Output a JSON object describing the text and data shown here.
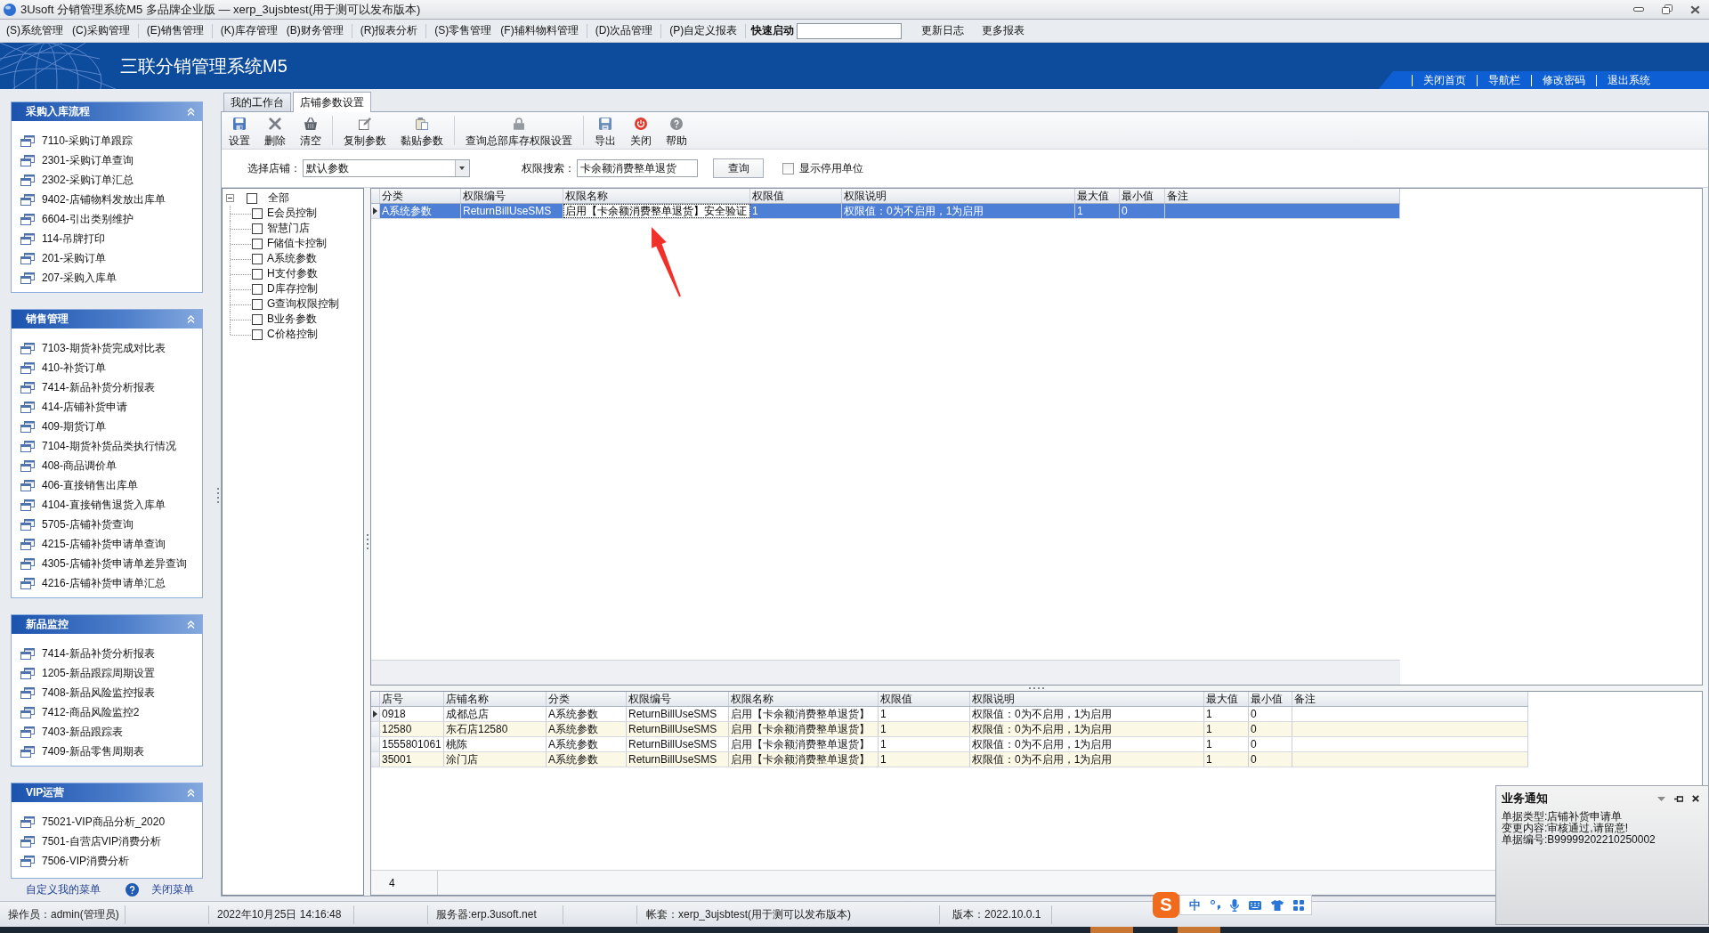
{
  "window": {
    "title": "3Usoft 分销管理系统M5 多品牌企业版 — xerp_3ujsbtest(用于测可以发布版本)"
  },
  "menu_bar": {
    "groups": [
      [
        "(S)系统管理",
        "(C)采购管理"
      ],
      [
        "(E)销售管理"
      ],
      [
        "(K)库存管理",
        "(B)财务管理"
      ],
      [
        "(R)报表分析"
      ],
      [
        "(S)零售管理",
        "(F)辅料物料管理"
      ],
      [
        "(D)次品管理"
      ],
      [
        "(P)自定义报表"
      ]
    ],
    "quick_launch": {
      "label": "快速启动"
    },
    "links": [
      "更新日志",
      "更多报表"
    ]
  },
  "banner": {
    "title": "三联分销管理系统M5",
    "links": [
      "关闭首页",
      "导航栏",
      "修改密码",
      "退出系统"
    ]
  },
  "sidebar": {
    "sections": [
      {
        "title": "采购入库流程",
        "expanded": true,
        "items": [
          "7110-采购订单跟踪",
          "2301-采购订单查询",
          "2302-采购订单汇总",
          "9402-店铺物料发放出库单",
          "6604-引出类别维护",
          "114-吊牌打印",
          "201-采购订单",
          "207-采购入库单"
        ]
      },
      {
        "title": "销售管理",
        "expanded": true,
        "items": [
          "7103-期货补货完成对比表",
          "410-补货订单",
          "7414-新品补货分析报表",
          "414-店铺补货申请",
          "409-期货订单",
          "7104-期货补货品类执行情况",
          "408-商品调价单",
          "406-直接销售出库单",
          "4104-直接销售退货入库单",
          "5705-店铺补货查询",
          "4215-店铺补货申请单查询",
          "4305-店铺补货申请单差异查询",
          "4216-店铺补货申请单汇总"
        ]
      },
      {
        "title": "新品监控",
        "expanded": true,
        "items": [
          "7414-新品补货分析报表",
          "1205-新品跟踪周期设置",
          "7408-新品风险监控报表",
          "7412-商品风险监控2",
          "7403-新品跟踪表",
          "7409-新品零售周期表"
        ]
      },
      {
        "title": "VIP运营",
        "expanded": true,
        "items": [
          "75021-VIP商品分析_2020",
          "7501-自营店VIP消费分析",
          "7506-VIP消费分析"
        ]
      }
    ],
    "footer": {
      "customize_link": "自定义我的菜单",
      "close_link": "关闭菜单"
    }
  },
  "tabs": [
    {
      "label": "我的工作台",
      "selected": false
    },
    {
      "label": "店铺参数设置",
      "selected": true
    }
  ],
  "toolbar": {
    "groups": [
      [
        "设置",
        "删除",
        "清空"
      ],
      [
        "复制参数",
        "黏贴参数"
      ],
      [
        "查询总部库存权限设置"
      ],
      [
        "导出",
        "关闭",
        "帮助"
      ]
    ]
  },
  "filters": {
    "store": {
      "label": "选择店铺：",
      "value": "默认参数"
    },
    "search": {
      "label": "权限搜索：",
      "value": "卡余额消费整单退货"
    },
    "query_button": "查询",
    "show_disabled": {
      "label": "显示停用单位",
      "checked": false
    }
  },
  "tree": {
    "label": "全部",
    "checked": false,
    "expanded": true,
    "children": [
      {
        "label": "E会员控制",
        "checked": false
      },
      {
        "label": "智慧门店",
        "checked": false
      },
      {
        "label": "F储值卡控制",
        "checked": false
      },
      {
        "label": "A系统参数",
        "checked": false
      },
      {
        "label": "H支付参数",
        "checked": false
      },
      {
        "label": "D库存控制",
        "checked": false
      },
      {
        "label": "G查询权限控制",
        "checked": false
      },
      {
        "label": "B业务参数",
        "checked": false
      },
      {
        "label": "C价格控制",
        "checked": false
      }
    ]
  },
  "permission_table": {
    "columns": [
      "分类",
      "权限编号",
      "权限名称",
      "权限值",
      "权限说明",
      "最大值",
      "最小值",
      "备注"
    ],
    "rows": [
      {
        "selected": true,
        "cells": [
          {
            "text": "A系统参数",
            "focused": false
          },
          {
            "text": "ReturnBillUseSMS",
            "focused": false
          },
          {
            "text": "启用【卡余额消费整单退货】安全验证",
            "focused": true
          },
          {
            "text": "1",
            "focused": false
          },
          {
            "text": "权限值：0为不启用，1为启用",
            "focused": false
          },
          {
            "text": "1",
            "focused": false
          },
          {
            "text": "0",
            "focused": false
          }
        ]
      }
    ]
  },
  "store_table": {
    "columns": [
      "店号",
      "店铺名称",
      "分类",
      "权限编号",
      "权限名称",
      "权限值",
      "权限说明",
      "最大值",
      "最小值",
      "备注"
    ],
    "rows": [
      {
        "selected": true,
        "cells": [
          "0918",
          "成都总店",
          "A系统参数",
          "ReturnBillUseSMS",
          "启用【卡余额消费整单退货】",
          "1",
          "权限值：0为不启用，1为启用",
          "1",
          "0"
        ]
      },
      {
        "selected": false,
        "cells": [
          "12580",
          "东石店12580",
          "A系统参数",
          "ReturnBillUseSMS",
          "启用【卡余额消费整单退货】",
          "1",
          "权限值：0为不启用，1为启用",
          "1",
          "0"
        ]
      },
      {
        "selected": false,
        "cells": [
          "1555801061",
          "桃陈",
          "A系统参数",
          "ReturnBillUseSMS",
          "启用【卡余额消费整单退货】",
          "1",
          "权限值：0为不启用，1为启用",
          "1",
          "0"
        ]
      },
      {
        "selected": false,
        "cells": [
          "35001",
          "涂门店",
          "A系统参数",
          "ReturnBillUseSMS",
          "启用【卡余额消费整单退货】",
          "1",
          "权限值：0为不启用，1为启用",
          "1",
          "0"
        ]
      }
    ],
    "footer_count": "4"
  },
  "notification": {
    "title": "业务通知",
    "lines": [
      "单据类型:店铺补货申请单",
      "变更内容:审核通过,请留意!",
      "单据编号:B99999202210250002"
    ]
  },
  "status_bar": {
    "segments": [
      "操作员：admin(管理员)",
      "2022年10月25日 14:16:48",
      "服务器:erp.3usoft.net",
      "帐套：xerp_3ujsbtest(用于测可以发布版本)",
      "版本：2022.10.0.1"
    ]
  },
  "ime_toolbar": {
    "logo": "S",
    "mode": "中"
  }
}
